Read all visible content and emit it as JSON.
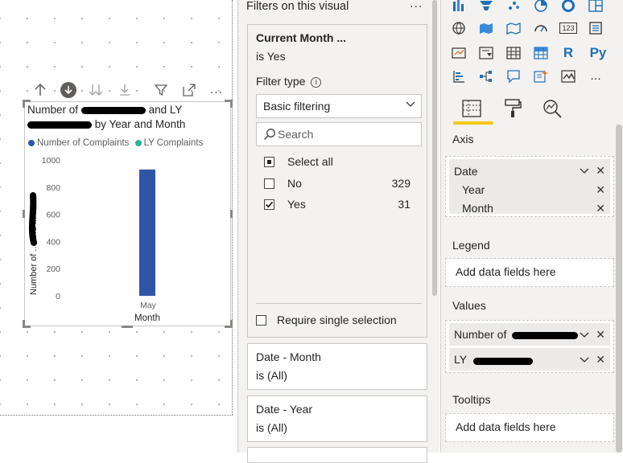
{
  "canvas": {
    "visual": {
      "title_prefix": "Number of",
      "title_mid": "and LY",
      "title_line2": "by Year and Month",
      "legend": [
        {
          "label": "Number of Complaints",
          "color": "#2f56a6"
        },
        {
          "label": "LY Complaints",
          "color": "#2ab39a"
        }
      ],
      "y_axis_title": "Number of ... and ...",
      "x_axis_title": "Month"
    }
  },
  "chart_data": {
    "type": "bar",
    "categories": [
      "May"
    ],
    "series": [
      {
        "name": "Number of Complaints",
        "values": [
          930
        ],
        "color": "#2f56a6"
      },
      {
        "name": "LY Complaints",
        "values": [
          0
        ],
        "color": "#2ab39a"
      }
    ],
    "yticks": [
      0,
      200,
      400,
      600,
      800,
      1000
    ],
    "ylim": [
      0,
      1000
    ],
    "xlabel": "Month",
    "grid": false,
    "legend_position": "top-left"
  },
  "filters": {
    "title": "Filters on this visual",
    "more": "...",
    "current": {
      "name": "Current Month ...",
      "state": "is Yes",
      "filter_type_label": "Filter type",
      "filter_type_value": "Basic filtering",
      "search_placeholder": "Search",
      "options": [
        {
          "label": "Select all",
          "count": "",
          "checked": "partial"
        },
        {
          "label": "No",
          "count": "329",
          "checked": "no"
        },
        {
          "label": "Yes",
          "count": "31",
          "checked": "yes"
        }
      ],
      "require_single": "Require single selection"
    },
    "other_cards": [
      {
        "name": "Date - Month",
        "state": "is (All)"
      },
      {
        "name": "Date - Year",
        "state": "is (All)"
      }
    ]
  },
  "viz": {
    "sections": {
      "axis": "Axis",
      "legend": "Legend",
      "values": "Values",
      "tooltips": "Tooltips"
    },
    "axis_fields": {
      "parent": "Date",
      "children": [
        "Year",
        "Month"
      ]
    },
    "legend_placeholder": "Add data fields here",
    "value_fields": [
      "Number of",
      "LY"
    ],
    "tooltips_placeholder": "Add data fields here",
    "icon_text": {
      "r": "R",
      "py": "Py",
      "numcard": "123",
      "more": "..."
    }
  }
}
